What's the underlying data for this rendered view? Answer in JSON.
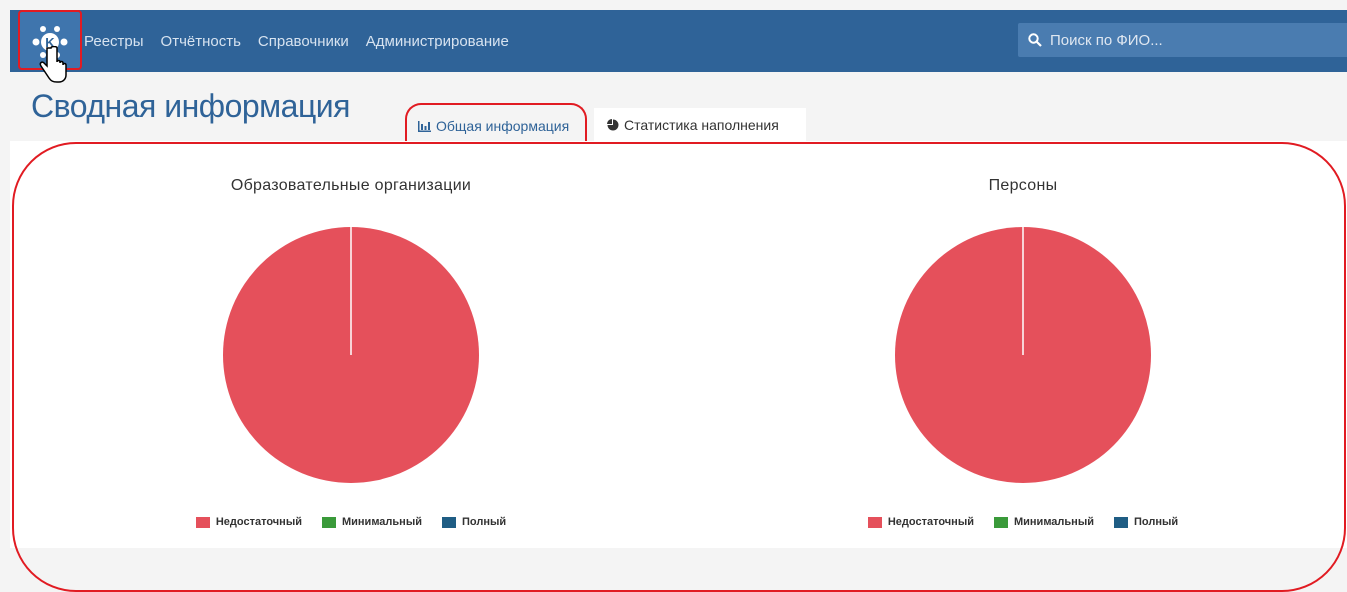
{
  "nav": {
    "items": [
      "Реестры",
      "Отчётность",
      "Справочники",
      "Администрирование"
    ]
  },
  "search": {
    "placeholder": "Поиск по ФИО..."
  },
  "page": {
    "title": "Сводная информация"
  },
  "tabs": [
    {
      "label": "Общая информация",
      "icon": "bar-chart-icon",
      "active": true
    },
    {
      "label": "Статистика наполнения",
      "icon": "pie-chart-icon",
      "active": false
    }
  ],
  "colors": {
    "primary": "#2f6398",
    "insufficient": "#e5505b",
    "minimal": "#3a9a3a",
    "full": "#1f5d84",
    "highlight": "#e11b22"
  },
  "legend": [
    "Недостаточный",
    "Минимальный",
    "Полный"
  ],
  "chart_data": [
    {
      "type": "pie",
      "title": "Образовательные организации",
      "categories": [
        "Недостаточный",
        "Минимальный",
        "Полный"
      ],
      "values": [
        100,
        0,
        0
      ]
    },
    {
      "type": "pie",
      "title": "Персоны",
      "categories": [
        "Недостаточный",
        "Минимальный",
        "Полный"
      ],
      "values": [
        100,
        0,
        0
      ]
    }
  ]
}
